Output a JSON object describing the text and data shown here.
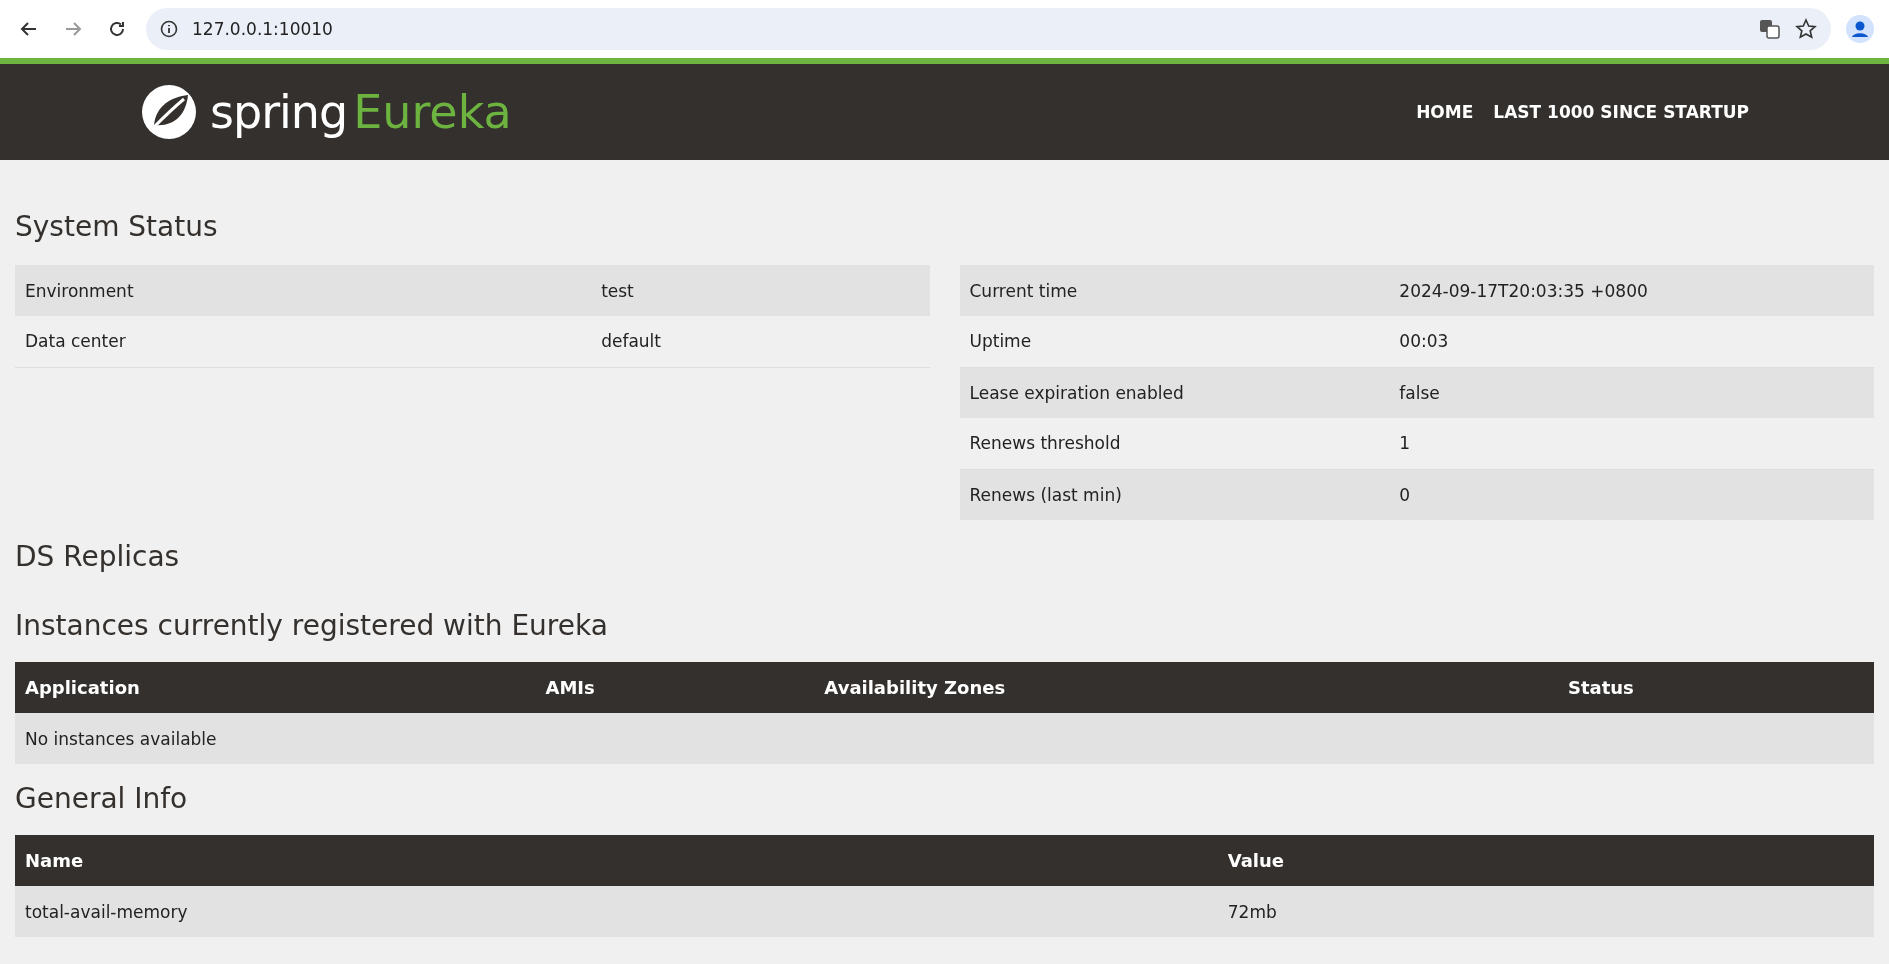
{
  "browser": {
    "url": "127.0.0.1:10010"
  },
  "navbar": {
    "brand_word": "spring",
    "brand_product": "Eureka",
    "links": [
      {
        "label": "HOME"
      },
      {
        "label": "LAST 1000 SINCE STARTUP"
      }
    ]
  },
  "system_status": {
    "title": "System Status",
    "left": [
      {
        "label": "Environment",
        "value": "test"
      },
      {
        "label": "Data center",
        "value": "default"
      }
    ],
    "right": [
      {
        "label": "Current time",
        "value": "2024-09-17T20:03:35 +0800"
      },
      {
        "label": "Uptime",
        "value": "00:03"
      },
      {
        "label": "Lease expiration enabled",
        "value": "false"
      },
      {
        "label": "Renews threshold",
        "value": "1"
      },
      {
        "label": "Renews (last min)",
        "value": "0"
      }
    ]
  },
  "ds_replicas": {
    "title": "DS Replicas"
  },
  "instances": {
    "title": "Instances currently registered with Eureka",
    "columns": [
      "Application",
      "AMIs",
      "Availability Zones",
      "Status"
    ],
    "empty_message": "No instances available"
  },
  "general_info": {
    "title": "General Info",
    "columns": [
      "Name",
      "Value"
    ],
    "rows": [
      {
        "name": "total-avail-memory",
        "value": "72mb"
      }
    ]
  }
}
